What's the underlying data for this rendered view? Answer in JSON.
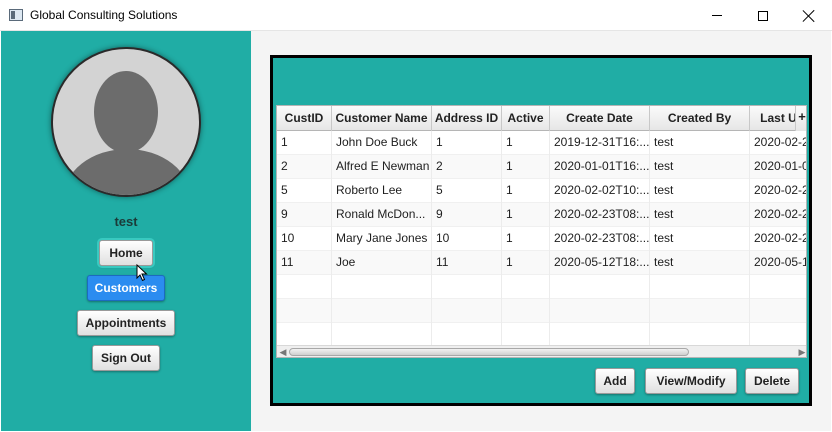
{
  "window": {
    "title": "Global Consulting Solutions"
  },
  "sidebar": {
    "username": "test",
    "buttons": {
      "home": "Home",
      "customers": "Customers",
      "appointments": "Appointments",
      "sign_out": "Sign Out"
    }
  },
  "table": {
    "columns": [
      "CustID",
      "Customer Name",
      "Address ID",
      "Active",
      "Create Date",
      "Created By",
      "Last U"
    ],
    "corner_label": "+",
    "rows": [
      [
        "1",
        "John Doe Buck",
        "1",
        "1",
        "2019-12-31T16:...",
        "test",
        "2020-02-2"
      ],
      [
        "2",
        "Alfred E Newman",
        "2",
        "1",
        "2020-01-01T16:...",
        "test",
        "2020-01-0"
      ],
      [
        "5",
        "Roberto Lee",
        "5",
        "1",
        "2020-02-02T10:...",
        "test",
        "2020-02-2"
      ],
      [
        "9",
        "Ronald McDon...",
        "9",
        "1",
        "2020-02-23T08:...",
        "test",
        "2020-02-2"
      ],
      [
        "10",
        "Mary Jane Jones",
        "10",
        "1",
        "2020-02-23T08:...",
        "test",
        "2020-02-2"
      ],
      [
        "11",
        "Joe",
        "11",
        "1",
        "2020-05-12T18:...",
        "test",
        "2020-05-1"
      ]
    ]
  },
  "actions": {
    "add": "Add",
    "view_modify": "View/Modify",
    "delete": "Delete"
  },
  "colors": {
    "sidebar_bg": "#20ada5",
    "panel_bg": "#20ada5",
    "selected_button": "#2b8cf0"
  },
  "icons": {
    "app": "app-window-icon",
    "minimize": "minimize-icon",
    "maximize": "maximize-icon",
    "close": "close-icon",
    "avatar": "user-silhouette-icon",
    "cursor": "mouse-pointer-icon"
  }
}
